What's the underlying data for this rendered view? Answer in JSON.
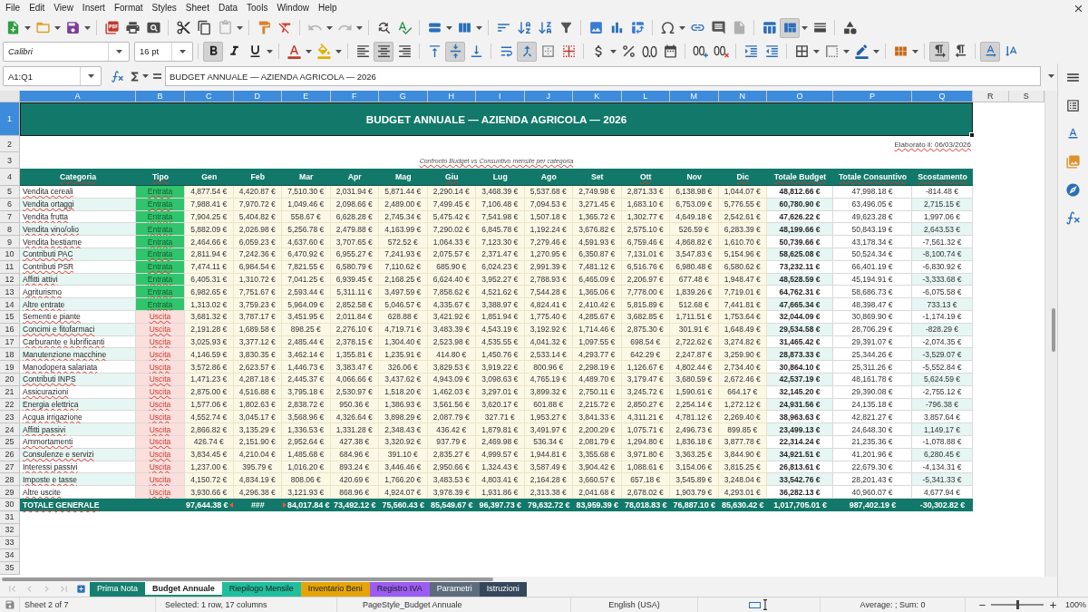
{
  "menu_bar": [
    "File",
    "Edit",
    "View",
    "Insert",
    "Format",
    "Styles",
    "Sheet",
    "Data",
    "Tools",
    "Window",
    "Help"
  ],
  "standard_toolbar": {
    "paste_disabled": true,
    "undo_disabled": true,
    "redo_disabled": true,
    "freeze_panes": true
  },
  "formatting_toolbar": {
    "font_name": "Calibri",
    "font_size": "16 pt",
    "bold": true,
    "italic": false,
    "underline": false,
    "align_left": false,
    "align_center": true,
    "align_right": false,
    "align_top": false,
    "align_middle": true,
    "align_bottom": false,
    "merge_and_center": true,
    "left_to_right": true,
    "right_to_left": false,
    "text_horizontal": true,
    "text_vertical": false
  },
  "formula_bar": {
    "name_box": "A1:Q1",
    "content": "BUDGET ANNUALE — AZIENDA AGRICOLA — 2026"
  },
  "columns": [
    {
      "label": "A",
      "selected": true
    },
    {
      "label": "B",
      "selected": true
    },
    {
      "label": "C",
      "selected": true
    },
    {
      "label": "D",
      "selected": true
    },
    {
      "label": "E",
      "selected": true
    },
    {
      "label": "F",
      "selected": true
    },
    {
      "label": "G",
      "selected": true
    },
    {
      "label": "H",
      "selected": true
    },
    {
      "label": "I",
      "selected": true
    },
    {
      "label": "J",
      "selected": true
    },
    {
      "label": "K",
      "selected": true
    },
    {
      "label": "L",
      "selected": true
    },
    {
      "label": "M",
      "selected": true
    },
    {
      "label": "N",
      "selected": true
    },
    {
      "label": "O",
      "selected": true
    },
    {
      "label": "P",
      "selected": true
    },
    {
      "label": "Q",
      "selected": true
    },
    {
      "label": "R",
      "selected": false
    },
    {
      "label": "S",
      "selected": false
    }
  ],
  "row_numbers": [
    {
      "label": "1",
      "selected": true
    },
    {
      "label": "2",
      "selected": false
    },
    {
      "label": "3",
      "selected": false
    },
    {
      "label": "4",
      "selected": false
    },
    {
      "label": "5",
      "selected": false
    },
    {
      "label": "6",
      "selected": false
    },
    {
      "label": "7",
      "selected": false
    },
    {
      "label": "8",
      "selected": false
    },
    {
      "label": "9",
      "selected": false
    },
    {
      "label": "10",
      "selected": false
    },
    {
      "label": "11",
      "selected": false
    },
    {
      "label": "12",
      "selected": false
    },
    {
      "label": "13",
      "selected": false
    },
    {
      "label": "14",
      "selected": false
    },
    {
      "label": "15",
      "selected": false
    },
    {
      "label": "16",
      "selected": false
    },
    {
      "label": "17",
      "selected": false
    },
    {
      "label": "18",
      "selected": false
    },
    {
      "label": "19",
      "selected": false
    },
    {
      "label": "20",
      "selected": false
    },
    {
      "label": "21",
      "selected": false
    },
    {
      "label": "22",
      "selected": false
    },
    {
      "label": "23",
      "selected": false
    },
    {
      "label": "24",
      "selected": false
    },
    {
      "label": "25",
      "selected": false
    },
    {
      "label": "26",
      "selected": false
    },
    {
      "label": "27",
      "selected": false
    },
    {
      "label": "28",
      "selected": false
    },
    {
      "label": "29",
      "selected": false
    },
    {
      "label": "30",
      "selected": false
    },
    {
      "label": "31",
      "selected": false
    },
    {
      "label": "32",
      "selected": false
    },
    {
      "label": "33",
      "selected": false
    },
    {
      "label": "34",
      "selected": false
    },
    {
      "label": "35",
      "selected": false
    }
  ],
  "sheet": {
    "title": "BUDGET ANNUALE — AZIENDA AGRICOLA — 2026",
    "date_note": "Elaborato il: 06/03/2026",
    "subtitle": "Confronto Budget vs Consuntivo mensile per categoria",
    "autospellcheck": true,
    "headers": [
      {
        "label": "Categoria",
        "spell_error": true
      },
      {
        "label": "Tipo",
        "spell_error": true
      },
      {
        "label": "Gen",
        "spell_error": false
      },
      {
        "label": "Feb",
        "spell_error": false
      },
      {
        "label": "Mar",
        "spell_error": false
      },
      {
        "label": "Apr",
        "spell_error": false
      },
      {
        "label": "Mag",
        "spell_error": false
      },
      {
        "label": "Giu",
        "spell_error": true
      },
      {
        "label": "Lug",
        "spell_error": false
      },
      {
        "label": "Ago",
        "spell_error": false
      },
      {
        "label": "Set",
        "spell_error": false
      },
      {
        "label": "Ott",
        "spell_error": true
      },
      {
        "label": "Nov",
        "spell_error": false
      },
      {
        "label": "Dic",
        "spell_error": true
      },
      {
        "label": "Totale Budget",
        "spell_error": true
      },
      {
        "label": "Totale Consuntivo",
        "spell_error": true
      },
      {
        "label": "Scostamento",
        "spell_error": true
      }
    ],
    "rows": [
      {
        "category": "Vendita cereali",
        "type": "Entrata",
        "kind": "income",
        "months": [
          "4,877.54 €",
          "4,420.87 €",
          "7,510.30 €",
          "2,031.94 €",
          "5,871.44 €",
          "2,290.14 €",
          "3,468.39 €",
          "5,537.68 €",
          "2,749.98 €",
          "2,871.33 €",
          "6,138.98 €",
          "1,044.07 €"
        ],
        "total_budget": "48,812.66 €",
        "total_actual": "47,998.18 €",
        "variance": "-814.48 €"
      },
      {
        "category": "Vendita ortaggi",
        "type": "Entrata",
        "kind": "income",
        "months": [
          "7,988.41 €",
          "7,970.72 €",
          "1,049.46 €",
          "2,098.66 €",
          "2,489.00 €",
          "7,499.45 €",
          "7,106.48 €",
          "7,094.53 €",
          "3,271.45 €",
          "1,683.10 €",
          "6,753.09 €",
          "5,776.55 €"
        ],
        "total_budget": "60,780.90 €",
        "total_actual": "63,496.05 €",
        "variance": "2,715.15 €"
      },
      {
        "category": "Vendita frutta",
        "type": "Entrata",
        "kind": "income",
        "months": [
          "7,904.25 €",
          "5,404.82 €",
          "558.67 €",
          "6,628.28 €",
          "2,745.34 €",
          "5,475.42 €",
          "7,541.98 €",
          "1,507.18 €",
          "1,365.72 €",
          "1,302.77 €",
          "4,649.18 €",
          "2,542.61 €"
        ],
        "total_budget": "47,626.22 €",
        "total_actual": "49,623.28 €",
        "variance": "1,997.06 €"
      },
      {
        "category": "Vendita vino/olio",
        "type": "Entrata",
        "kind": "income",
        "months": [
          "5,882.09 €",
          "2,026.98 €",
          "5,256.78 €",
          "2,479.88 €",
          "4,163.99 €",
          "7,290.02 €",
          "6,845.78 €",
          "1,192.24 €",
          "3,676.82 €",
          "2,575.10 €",
          "526.59 €",
          "6,283.39 €"
        ],
        "total_budget": "48,199.66 €",
        "total_actual": "50,843.19 €",
        "variance": "2,643.53 €"
      },
      {
        "category": "Vendita bestiame",
        "type": "Entrata",
        "kind": "income",
        "months": [
          "2,464.66 €",
          "6,059.23 €",
          "4,637.60 €",
          "3,707.65 €",
          "572.52 €",
          "1,064.33 €",
          "7,123.30 €",
          "7,279.46 €",
          "4,591.93 €",
          "6,759.46 €",
          "4,868.82 €",
          "1,610.70 €"
        ],
        "total_budget": "50,739.66 €",
        "total_actual": "43,178.34 €",
        "variance": "-7,561.32 €"
      },
      {
        "category": "Contributi PAC",
        "type": "Entrata",
        "kind": "income",
        "months": [
          "2,811.94 €",
          "7,242.36 €",
          "6,470.92 €",
          "6,955.27 €",
          "7,241.93 €",
          "2,075.57 €",
          "2,371.47 €",
          "1,270.95 €",
          "6,350.87 €",
          "7,131.01 €",
          "3,547.83 €",
          "5,154.96 €"
        ],
        "total_budget": "58,625.08 €",
        "total_actual": "50,524.34 €",
        "variance": "-8,100.74 €"
      },
      {
        "category": "Contributi PSR",
        "type": "Entrata",
        "kind": "income",
        "months": [
          "7,474.11 €",
          "6,984.54 €",
          "7,821.55 €",
          "6,580.79 €",
          "7,110.62 €",
          "685.90 €",
          "6,024.23 €",
          "2,991.39 €",
          "7,481.12 €",
          "6,516.76 €",
          "6,980.48 €",
          "6,580.62 €"
        ],
        "total_budget": "73,232.11 €",
        "total_actual": "66,401.19 €",
        "variance": "-6,830.92 €"
      },
      {
        "category": "Affitti attivi",
        "type": "Entrata",
        "kind": "income",
        "months": [
          "6,405.31 €",
          "1,310.72 €",
          "7,041.25 €",
          "6,939.45 €",
          "2,168.25 €",
          "6,624.40 €",
          "3,952.27 €",
          "2,788.93 €",
          "6,465.09 €",
          "2,206.97 €",
          "677.48 €",
          "1,948.47 €"
        ],
        "total_budget": "48,528.59 €",
        "total_actual": "45,194.91 €",
        "variance": "-3,333.68 €"
      },
      {
        "category": "Agriturismo",
        "type": "Entrata",
        "kind": "income",
        "months": [
          "6,982.65 €",
          "7,751.67 €",
          "2,593.44 €",
          "5,311.11 €",
          "3,497.59 €",
          "7,858.62 €",
          "4,521.62 €",
          "7,544.28 €",
          "1,365.06 €",
          "7,778.00 €",
          "1,839.26 €",
          "7,719.01 €"
        ],
        "total_budget": "64,762.31 €",
        "total_actual": "58,686.73 €",
        "variance": "-6,075.58 €"
      },
      {
        "category": "Altre entrate",
        "type": "Entrata",
        "kind": "income",
        "months": [
          "1,313.02 €",
          "3,759.23 €",
          "5,964.09 €",
          "2,852.58 €",
          "5,046.57 €",
          "4,335.67 €",
          "3,388.97 €",
          "4,824.41 €",
          "2,410.42 €",
          "5,815.89 €",
          "512.68 €",
          "7,441.81 €"
        ],
        "total_budget": "47,665.34 €",
        "total_actual": "48,398.47 €",
        "variance": "733.13 €"
      },
      {
        "category": "Sementi e piante",
        "type": "Uscita",
        "kind": "expense",
        "months": [
          "3,681.32 €",
          "3,787.17 €",
          "3,451.95 €",
          "2,011.84 €",
          "628.88 €",
          "3,421.92 €",
          "1,851.94 €",
          "1,775.40 €",
          "4,285.67 €",
          "3,682.85 €",
          "1,711.51 €",
          "1,753.64 €"
        ],
        "total_budget": "32,044.09 €",
        "total_actual": "30,869.90 €",
        "variance": "-1,174.19 €"
      },
      {
        "category": "Concimi e fitofarmaci",
        "type": "Uscita",
        "kind": "expense",
        "months": [
          "2,191.28 €",
          "1,689.58 €",
          "898.25 €",
          "2,276.10 €",
          "4,719.71 €",
          "3,483.39 €",
          "4,543.19 €",
          "3,192.92 €",
          "1,714.46 €",
          "2,875.30 €",
          "301.91 €",
          "1,648.49 €"
        ],
        "total_budget": "29,534.58 €",
        "total_actual": "28,706.29 €",
        "variance": "-828.29 €"
      },
      {
        "category": "Carburante e lubrificanti",
        "type": "Uscita",
        "kind": "expense",
        "months": [
          "3,025.93 €",
          "3,377.12 €",
          "2,485.44 €",
          "2,378.15 €",
          "1,304.40 €",
          "2,523.98 €",
          "4,535.55 €",
          "4,041.32 €",
          "1,097.55 €",
          "698.54 €",
          "2,722.62 €",
          "3,274.82 €"
        ],
        "total_budget": "31,465.42 €",
        "total_actual": "29,391.07 €",
        "variance": "-2,074.35 €"
      },
      {
        "category": "Manutenzione macchine",
        "type": "Uscita",
        "kind": "expense",
        "months": [
          "4,146.59 €",
          "3,830.35 €",
          "3,462.14 €",
          "1,355.81 €",
          "1,235.91 €",
          "414.80 €",
          "1,450.76 €",
          "2,533.14 €",
          "4,293.77 €",
          "642.29 €",
          "2,247.87 €",
          "3,259.90 €"
        ],
        "total_budget": "28,873.33 €",
        "total_actual": "25,344.26 €",
        "variance": "-3,529.07 €"
      },
      {
        "category": "Manodopera salariata",
        "type": "Uscita",
        "kind": "expense",
        "months": [
          "3,572.86 €",
          "2,623.57 €",
          "1,446.73 €",
          "3,383.47 €",
          "326.06 €",
          "3,829.53 €",
          "3,919.22 €",
          "800.96 €",
          "2,298.19 €",
          "1,126.67 €",
          "4,802.44 €",
          "2,734.40 €"
        ],
        "total_budget": "30,864.10 €",
        "total_actual": "25,311.26 €",
        "variance": "-5,552.84 €"
      },
      {
        "category": "Contributi INPS",
        "type": "Uscita",
        "kind": "expense",
        "months": [
          "1,471.23 €",
          "4,287.18 €",
          "2,445.37 €",
          "4,066.66 €",
          "3,437.62 €",
          "4,943.09 €",
          "3,098.63 €",
          "4,765.19 €",
          "4,489.70 €",
          "3,179.47 €",
          "3,680.59 €",
          "2,672.46 €"
        ],
        "total_budget": "42,537.19 €",
        "total_actual": "48,161.78 €",
        "variance": "5,624.59 €"
      },
      {
        "category": "Assicurazioni",
        "type": "Uscita",
        "kind": "expense",
        "months": [
          "2,875.00 €",
          "4,516.88 €",
          "3,795.18 €",
          "2,530.97 €",
          "1,518.20 €",
          "1,462.03 €",
          "3,297.01 €",
          "3,899.32 €",
          "2,750.11 €",
          "3,245.72 €",
          "1,590.61 €",
          "664.17 €"
        ],
        "total_budget": "32,145.20 €",
        "total_actual": "29,390.08 €",
        "variance": "-2,755.12 €"
      },
      {
        "category": "Energia elettrica",
        "type": "Uscita",
        "kind": "expense",
        "months": [
          "1,577.06 €",
          "1,802.63 €",
          "2,838.72 €",
          "950.36 €",
          "1,386.93 €",
          "3,561.56 €",
          "3,620.17 €",
          "601.88 €",
          "2,215.72 €",
          "2,850.27 €",
          "2,254.14 €",
          "1,272.12 €"
        ],
        "total_budget": "24,931.56 €",
        "total_actual": "24,135.18 €",
        "variance": "-796.38 €"
      },
      {
        "category": "Acqua irrigazione",
        "type": "Uscita",
        "kind": "expense",
        "months": [
          "4,552.74 €",
          "3,045.17 €",
          "3,568.96 €",
          "4,326.64 €",
          "3,898.29 €",
          "2,087.79 €",
          "327.71 €",
          "1,953.27 €",
          "3,841.33 €",
          "4,311.21 €",
          "4,781.12 €",
          "2,269.40 €"
        ],
        "total_budget": "38,963.63 €",
        "total_actual": "42,821.27 €",
        "variance": "3,857.64 €"
      },
      {
        "category": "Affitti passivi",
        "type": "Uscita",
        "kind": "expense",
        "months": [
          "2,866.82 €",
          "3,135.29 €",
          "1,336.53 €",
          "1,331.28 €",
          "2,348.43 €",
          "436.42 €",
          "1,879.81 €",
          "3,491.97 €",
          "2,200.29 €",
          "1,075.71 €",
          "2,496.73 €",
          "899.85 €"
        ],
        "total_budget": "23,499.13 €",
        "total_actual": "24,648.30 €",
        "variance": "1,149.17 €"
      },
      {
        "category": "Ammortamenti",
        "type": "Uscita",
        "kind": "expense",
        "months": [
          "426.74 €",
          "2,151.90 €",
          "2,952.64 €",
          "427.38 €",
          "3,320.92 €",
          "937.79 €",
          "2,469.98 €",
          "536.34 €",
          "2,081.79 €",
          "1,294.80 €",
          "1,836.18 €",
          "3,877.78 €"
        ],
        "total_budget": "22,314.24 €",
        "total_actual": "21,235.36 €",
        "variance": "-1,078.88 €"
      },
      {
        "category": "Consulenze e servizi",
        "type": "Uscita",
        "kind": "expense",
        "months": [
          "3,834.45 €",
          "4,210.04 €",
          "1,485.68 €",
          "684.96 €",
          "391.10 €",
          "2,835.27 €",
          "4,999.57 €",
          "1,944.81 €",
          "3,355.68 €",
          "3,971.80 €",
          "3,363.25 €",
          "3,844.90 €"
        ],
        "total_budget": "34,921.51 €",
        "total_actual": "41,201.96 €",
        "variance": "6,280.45 €"
      },
      {
        "category": "Interessi passivi",
        "type": "Uscita",
        "kind": "expense",
        "months": [
          "1,237.00 €",
          "395.79 €",
          "1,016.20 €",
          "893.24 €",
          "3,446.46 €",
          "2,950.66 €",
          "1,324.43 €",
          "3,587.49 €",
          "3,904.42 €",
          "1,088.61 €",
          "3,154.06 €",
          "3,815.25 €"
        ],
        "total_budget": "26,813.61 €",
        "total_actual": "22,679.30 €",
        "variance": "-4,134.31 €"
      },
      {
        "category": "Imposte e tasse",
        "type": "Uscita",
        "kind": "expense",
        "months": [
          "4,150.72 €",
          "4,834.19 €",
          "808.06 €",
          "420.69 €",
          "1,766.20 €",
          "3,483.53 €",
          "4,803.41 €",
          "2,164.28 €",
          "3,660.57 €",
          "657.18 €",
          "3,545.89 €",
          "3,248.04 €"
        ],
        "total_budget": "33,542.76 €",
        "total_actual": "28,201.43 €",
        "variance": "-5,341.33 €"
      },
      {
        "category": "Altre uscite",
        "type": "Uscita",
        "kind": "expense",
        "months": [
          "3,930.66 €",
          "4,296.38 €",
          "3,121.93 €",
          "868.96 €",
          "4,924.07 €",
          "3,978.39 €",
          "1,931.86 €",
          "2,313.38 €",
          "2,041.68 €",
          "2,678.02 €",
          "1,903.79 €",
          "4,293.01 €"
        ],
        "total_budget": "36,282.13 €",
        "total_actual": "40,960.07 €",
        "variance": "4,677.94 €"
      }
    ],
    "totals": {
      "label": "TOTALE GENERALE",
      "cells": [
        {
          "value": "97,644.38 €",
          "clipped_right": true,
          "clipped_left": false
        },
        {
          "value": "###",
          "clipped_right": false,
          "clipped_left": false
        },
        {
          "value": "84,017.84 €",
          "clipped_right": false,
          "clipped_left": true
        },
        {
          "value": "73,492.12 €",
          "clipped_right": false,
          "clipped_left": false
        },
        {
          "value": "75,560.43 €",
          "clipped_right": false,
          "clipped_left": false
        },
        {
          "value": "85,549.67 €",
          "clipped_right": false,
          "clipped_left": false
        },
        {
          "value": "96,397.73 €",
          "clipped_right": false,
          "clipped_left": false
        },
        {
          "value": "79,632.72 €",
          "clipped_right": false,
          "clipped_left": false
        },
        {
          "value": "83,959.39 €",
          "clipped_right": false,
          "clipped_left": false
        },
        {
          "value": "78,018.83 €",
          "clipped_right": false,
          "clipped_left": false
        },
        {
          "value": "76,887.10 €",
          "clipped_right": false,
          "clipped_left": false
        },
        {
          "value": "85,630.42 €",
          "clipped_right": false,
          "clipped_left": false
        },
        {
          "value": "1,017,705.01 €",
          "clipped_right": false,
          "clipped_left": false
        },
        {
          "value": "987,402.19 €",
          "clipped_right": false,
          "clipped_left": false
        },
        {
          "value": "-30,302.82 €",
          "clipped_right": false,
          "clipped_left": false
        }
      ]
    }
  },
  "tab_bar": {
    "navigation_disabled": true,
    "tabs": [
      {
        "label": "Prima Nota",
        "color": "#15806f",
        "selected": false
      },
      {
        "label": "Budget Annuale",
        "color": "#1b8f74",
        "selected": true
      },
      {
        "label": "Riepilogo Mensile",
        "color": "#1fbf9d",
        "selected": false
      },
      {
        "label": "Inventario Beni",
        "color": "#e5a50a",
        "selected": false
      },
      {
        "label": "Registro IVA",
        "color": "#9b5cf2",
        "selected": false
      },
      {
        "label": "Parametri",
        "color": "#5d6b7c",
        "selected": false
      },
      {
        "label": "Istruzioni",
        "color": "#34475b",
        "selected": false
      }
    ]
  },
  "status_bar": {
    "sheet_position": "Sheet 2 of 7",
    "selection": "Selected: 1 row, 17 columns",
    "page_style": "PageStyle_Budget Annuale",
    "language": "English (USA)",
    "summary": "Average: ; Sum: 0",
    "zoom_slider": {
      "level": 0.5
    },
    "zoom": "100%"
  }
}
